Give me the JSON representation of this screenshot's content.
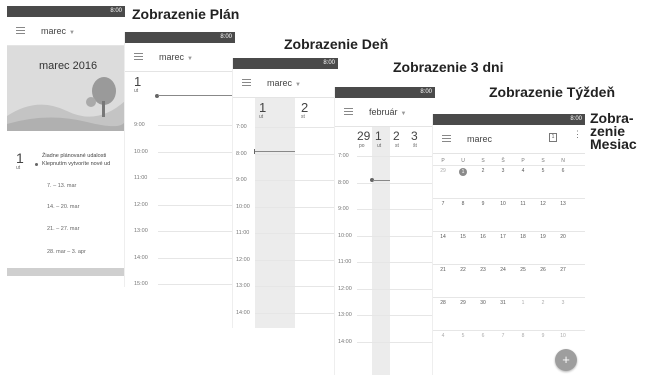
{
  "status": {
    "time": "8:00"
  },
  "captions": {
    "plan": "Zobrazenie Plán",
    "day": "Zobrazenie Deň",
    "three_days": "Zobrazenie 3 dni",
    "week": "Zobrazenie Týždeň",
    "month_line1": "Zobra-",
    "month_line2": "zenie",
    "month_line3": "Mesiac"
  },
  "plan": {
    "month": "marec",
    "banner": "marec 2016",
    "day_num": "1",
    "day_lbl": "ut",
    "empty_title": "Žiadne plánované udalosti",
    "empty_hint": "Klepnutím vytvoríte nové ud",
    "weeks": [
      "7. – 13. mar",
      "14. – 20. mar",
      "21. – 27. mar",
      "28. mar – 3. apr"
    ]
  },
  "day": {
    "month": "marec",
    "day_num": "1",
    "day_lbl": "ut",
    "hours": [
      "9:00",
      "10:00",
      "11:00",
      "12:00",
      "13:00",
      "14:00",
      "15:00"
    ]
  },
  "three": {
    "month": "marec",
    "days": [
      {
        "num": "1",
        "lbl": "ut"
      },
      {
        "num": "2",
        "lbl": "st"
      }
    ],
    "hours": [
      "7:00",
      "8:00",
      "9:00",
      "10:00",
      "11:00",
      "12:00",
      "13:00",
      "14:00"
    ]
  },
  "week": {
    "month": "február",
    "days": [
      {
        "num": "29",
        "lbl": "po"
      },
      {
        "num": "1",
        "lbl": "ut"
      },
      {
        "num": "2",
        "lbl": "st"
      },
      {
        "num": "3",
        "lbl": "št"
      }
    ],
    "hours": [
      "7:00",
      "8:00",
      "9:00",
      "10:00",
      "11:00",
      "12:00",
      "13:00",
      "14:00"
    ]
  },
  "month": {
    "month": "marec",
    "cal_icon": "1",
    "dows": [
      "P",
      "U",
      "S",
      "Š",
      "P",
      "S",
      "N"
    ],
    "rows": [
      [
        "29",
        "1",
        "2",
        "3",
        "4",
        "5",
        "6"
      ],
      [
        "7",
        "8",
        "9",
        "10",
        "11",
        "12",
        "13"
      ],
      [
        "14",
        "15",
        "16",
        "17",
        "18",
        "19",
        "20"
      ],
      [
        "21",
        "22",
        "23",
        "24",
        "25",
        "26",
        "27"
      ],
      [
        "28",
        "29",
        "30",
        "31",
        "1",
        "2",
        "3"
      ],
      [
        "4",
        "5",
        "6",
        "7",
        "8",
        "9",
        "10"
      ]
    ],
    "fab": "+"
  }
}
